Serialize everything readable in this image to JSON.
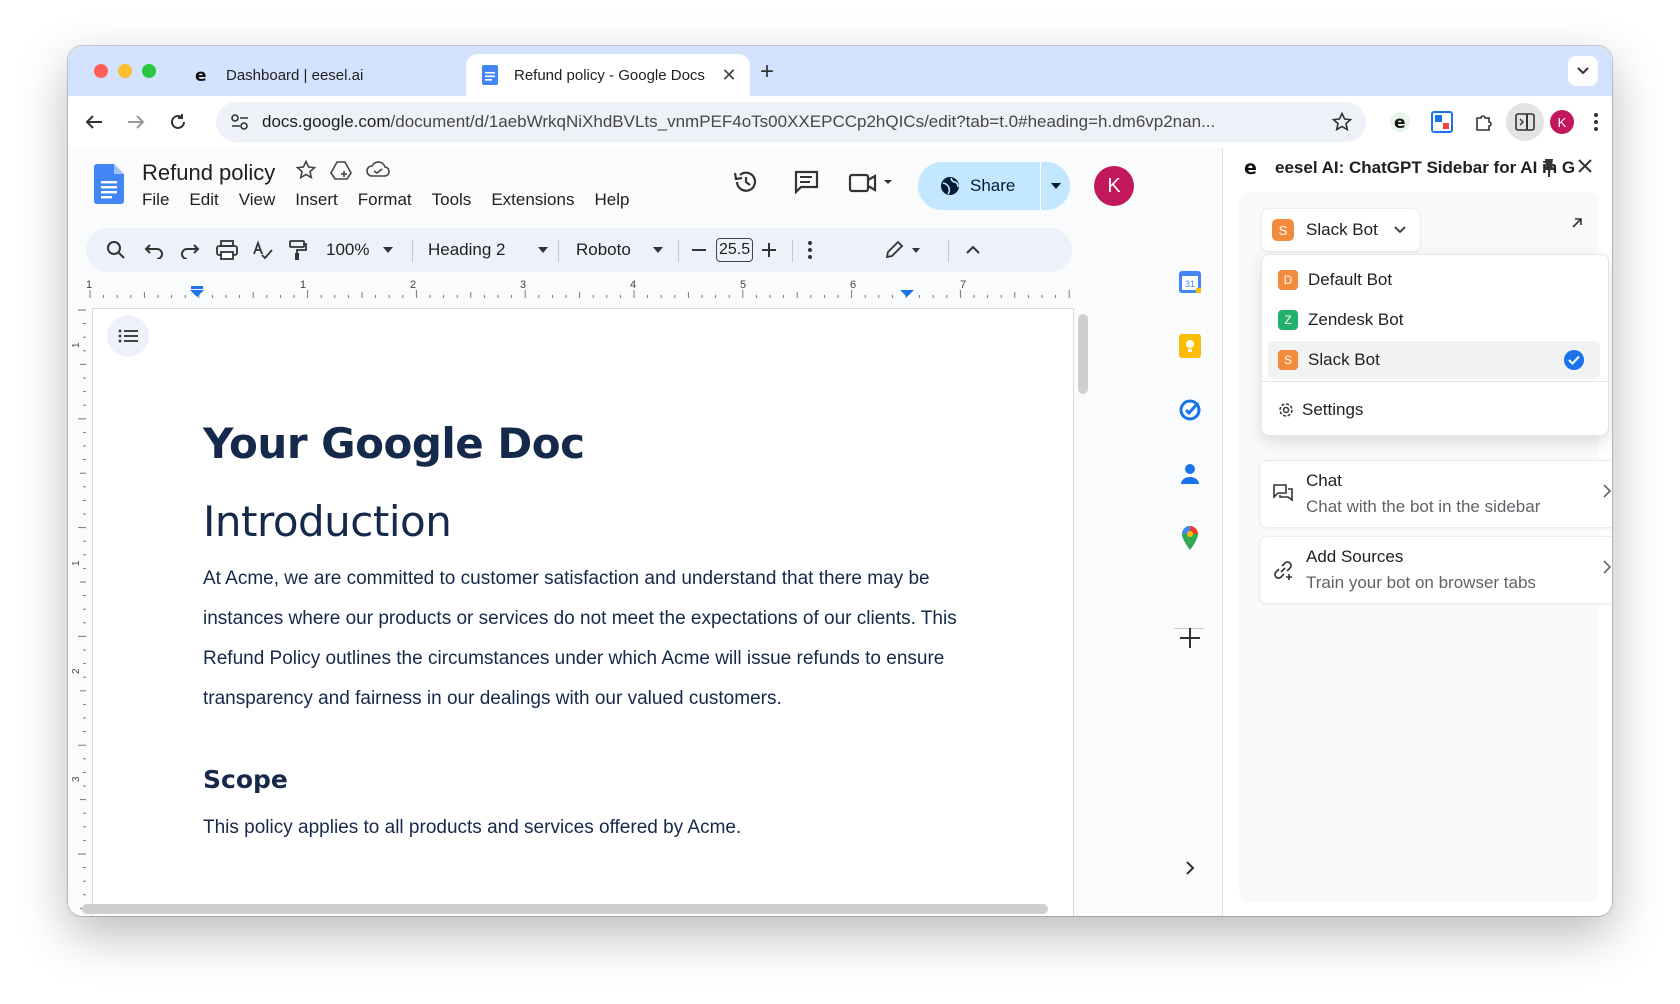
{
  "browser": {
    "tabs": [
      {
        "label": "Dashboard | eesel.ai",
        "favicon": "eesel-icon",
        "active": false
      },
      {
        "label": "Refund policy - Google Docs",
        "favicon": "docs-icon",
        "active": true
      }
    ],
    "url_host": "docs.google.com",
    "url_path": "/document/d/1aebWrkqNiXhdBVLts_vnmPEF4oTs00XXEPCCp2hQICs/edit?tab=t.0#heading=h.dm6vp2nan...",
    "profile_initial": "K"
  },
  "docs": {
    "title": "Refund policy",
    "menu": [
      "File",
      "Edit",
      "View",
      "Insert",
      "Format",
      "Tools",
      "Extensions",
      "Help"
    ],
    "share_label": "Share",
    "profile_initial": "K",
    "toolbar": {
      "zoom": "100%",
      "style": "Heading 2",
      "font": "Roboto",
      "font_size": "25.5"
    },
    "ruler_numbers": [
      "1",
      "1",
      "2",
      "3",
      "4",
      "5",
      "6",
      "7"
    ],
    "vruler_numbers": [
      "1",
      "1",
      "2",
      "3"
    ],
    "content": {
      "heading1": "Your Google Doc",
      "heading2": "Introduction",
      "paragraph": "At Acme, we are committed to customer satisfaction and understand that there may be instances where our products or services do not meet the expectations of our clients. This Refund Policy outlines the circumstances under which Acme will issue refunds to ensure transparency and fairness in our dealings with our valued customers.",
      "heading3": "Scope",
      "paragraph2": "This policy applies to all products and services offered by Acme."
    }
  },
  "panel": {
    "title": "eesel AI: ChatGPT Sidebar for AI in G...",
    "selected_bot": {
      "initial": "S",
      "label": "Slack Bot"
    },
    "bots": [
      {
        "initial": "D",
        "label": "Default Bot",
        "color": "#f28b3b"
      },
      {
        "initial": "Z",
        "label": "Zendesk Bot",
        "color": "#23b26d"
      },
      {
        "initial": "S",
        "label": "Slack Bot",
        "color": "#f28b3b",
        "selected": true
      }
    ],
    "settings_label": "Settings",
    "actions": [
      {
        "title": "Chat",
        "subtitle": "Chat with the bot in the sidebar",
        "icon": "chat-icon"
      },
      {
        "title": "Add Sources",
        "subtitle": "Train your bot on browser tabs",
        "icon": "link-icon"
      }
    ]
  },
  "colors": {
    "tabstrip": "#d3e3fd",
    "share": "#c2e7ff",
    "heading": "#15294a",
    "accent_blue": "#1a73e8",
    "avatar": "#c2185b"
  }
}
